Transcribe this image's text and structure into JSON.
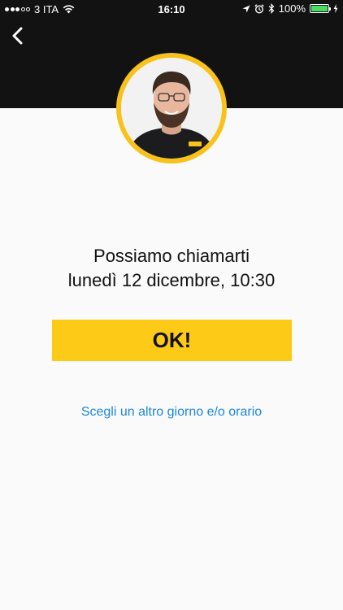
{
  "status_bar": {
    "signal_full": 3,
    "signal_total": 5,
    "carrier": "3 ITA",
    "time": "16:10",
    "battery": "100%",
    "battery_level": 1.0
  },
  "nav": {
    "back_icon": "chevron-left-icon"
  },
  "avatar": {
    "icon": "agent-photo",
    "ring_color": "#f9c21a"
  },
  "message": {
    "line1": "Possiamo chiamarti",
    "line2": "lunedì 12 dicembre, 10:30"
  },
  "actions": {
    "confirm_label": "OK!",
    "confirm_color": "#fcca17",
    "alternate_label": "Scegli un altro giorno e/o orario",
    "link_color": "#1f87d9"
  }
}
